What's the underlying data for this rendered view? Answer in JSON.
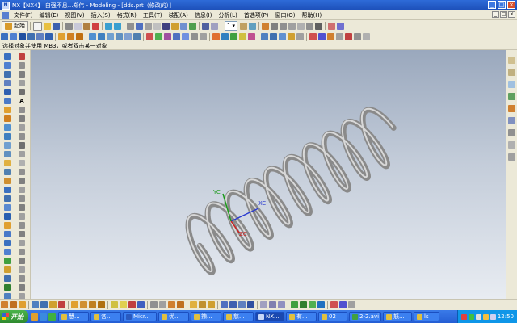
{
  "window": {
    "title": "NX【NX4】 自强不息...郑伟 - Modeling - [dds.prt（修改的）]",
    "controls": [
      "_",
      "□",
      "×"
    ]
  },
  "menu": {
    "items": [
      "文件(F)",
      "编辑(E)",
      "视图(V)",
      "插入(S)",
      "格式(R)",
      "工具(T)",
      "装配(A)",
      "信息(I)",
      "分析(L)",
      "首选项(P)",
      "窗口(O)",
      "帮助(H)"
    ],
    "mdi_controls": [
      "_",
      "□",
      "×"
    ]
  },
  "toolbar": {
    "start_label": "起始",
    "layer_value": "1"
  },
  "status": {
    "prompt": "选择对象并使用 MB3，或者双击某一对象"
  },
  "left_tools": {
    "text_tool_glyph": "A"
  },
  "viewport": {
    "axis_labels": {
      "x": "XC",
      "y": "YC",
      "z": "ZC"
    },
    "background_top": "#9aa8bd",
    "background_bottom": "#e8ecf2",
    "spring_color": "#8a8a8a"
  },
  "taskbar": {
    "start_label": "开始",
    "items": [
      "慧...",
      "各...",
      "Micr...",
      "优...",
      "辣...",
      "慈...",
      "NX...",
      "有...",
      "02",
      "2-2.avi",
      "怒...",
      "ls"
    ],
    "clock": "12:50"
  }
}
